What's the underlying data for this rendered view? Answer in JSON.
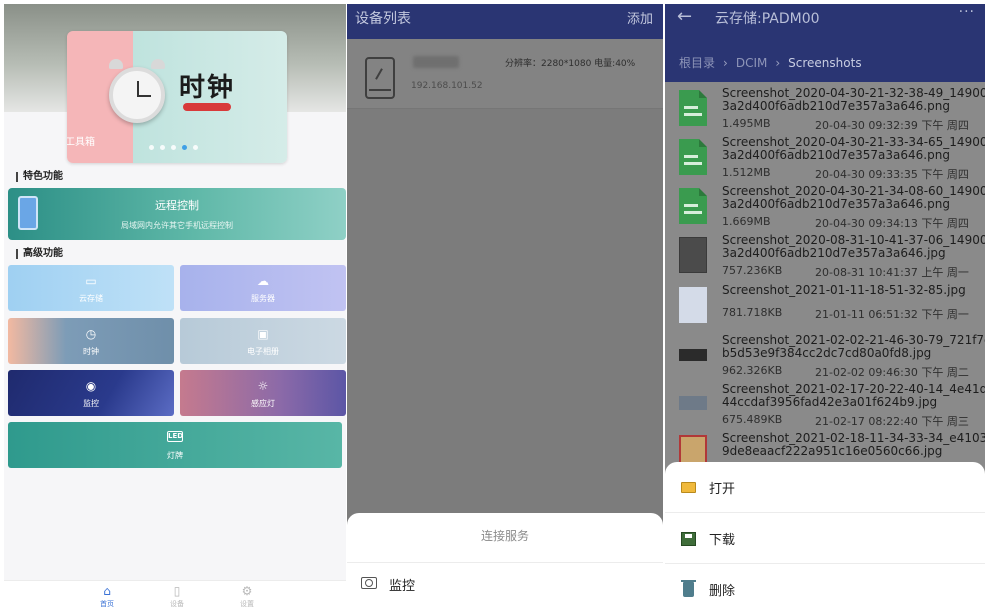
{
  "colors": {
    "header_blue": "#2a3573",
    "accent_blue": "#3a72d6",
    "teal": "#3fa59a"
  },
  "panel1": {
    "banner": {
      "title": "时钟",
      "subtitle": "工具箱",
      "dot_count": 5,
      "active_dot": 3
    },
    "section_featured": "特色功能",
    "remote": {
      "title": "远程控制",
      "subtitle": "局域网内允许其它手机远程控制"
    },
    "section_advanced": "高级功能",
    "tiles": [
      {
        "label": "云存储",
        "icon": "cloud-folder-icon"
      },
      {
        "label": "服务器",
        "icon": "cloud-server-icon"
      },
      {
        "label": "时钟",
        "icon": "clock-icon"
      },
      {
        "label": "电子相册",
        "icon": "photo-icon"
      },
      {
        "label": "监控",
        "icon": "camera-eye-icon"
      },
      {
        "label": "感应灯",
        "icon": "lightbulb-icon"
      }
    ],
    "led": {
      "label": "灯牌",
      "icon_text": "LED"
    },
    "nav": [
      {
        "label": "首页",
        "icon": "home-icon"
      },
      {
        "label": "设备",
        "icon": "device-icon"
      },
      {
        "label": "设置",
        "icon": "gear-icon"
      }
    ]
  },
  "panel2": {
    "title": "设备列表",
    "add_label": "添加",
    "device": {
      "info": "分辨率：2280*1080  电量:40%",
      "ip": "192.168.101.52"
    },
    "sheet": {
      "title": "连接服务",
      "item": "监控"
    }
  },
  "panel3": {
    "back": "←",
    "title": "云存储:PADM00",
    "more": "···",
    "breadcrumb": [
      "根目录",
      "DCIM",
      "Screenshots"
    ],
    "files": [
      {
        "name": "Screenshot_2020-04-30-21-32-38-49_14900\n3a2d400f6adb210d7e357a3a646.png",
        "size": "1.495MB",
        "date": "20-04-30 09:32:39 下午 周四",
        "thumb": "doc"
      },
      {
        "name": "Screenshot_2020-04-30-21-33-34-65_14900\n3a2d400f6adb210d7e357a3a646.png",
        "size": "1.512MB",
        "date": "20-04-30 09:33:35 下午 周四",
        "thumb": "doc"
      },
      {
        "name": "Screenshot_2020-04-30-21-34-08-60_14900\n3a2d400f6adb210d7e357a3a646.png",
        "size": "1.669MB",
        "date": "20-04-30 09:34:13 下午 周四",
        "thumb": "doc"
      },
      {
        "name": "Screenshot_2020-08-31-10-41-37-06_14900\n3a2d400f6adb210d7e357a3a646.jpg",
        "size": "757.236KB",
        "date": "20-08-31 10:41:37 上午 周一",
        "thumb": "thumb"
      },
      {
        "name": "Screenshot_2021-01-11-18-51-32-85.jpg",
        "size": "781.718KB",
        "date": "21-01-11 06:51:32 下午 周一",
        "thumb": "thumb2"
      },
      {
        "name": "Screenshot_2021-02-02-21-46-30-79_721f7c\nb5d53e9f384cc2dc7cd80a0fd8.jpg",
        "size": "962.326KB",
        "date": "21-02-02 09:46:30 下午 周二",
        "thumb": "thumb3"
      },
      {
        "name": "Screenshot_2021-02-17-20-22-40-14_4e41d\n44ccdaf3956fad42e3a01f624b9.jpg",
        "size": "675.489KB",
        "date": "21-02-17 08:22:40 下午 周三",
        "thumb": "thumb4"
      },
      {
        "name": "Screenshot_2021-02-18-11-34-33-34_e4103\n9de8eaacf222a951c16e0560c66.jpg",
        "size": "",
        "date": "",
        "thumb": "thumb5"
      }
    ],
    "sheet": [
      {
        "label": "打开",
        "icon": "folder-icon"
      },
      {
        "label": "下载",
        "icon": "save-icon"
      },
      {
        "label": "删除",
        "icon": "trash-icon"
      }
    ]
  }
}
